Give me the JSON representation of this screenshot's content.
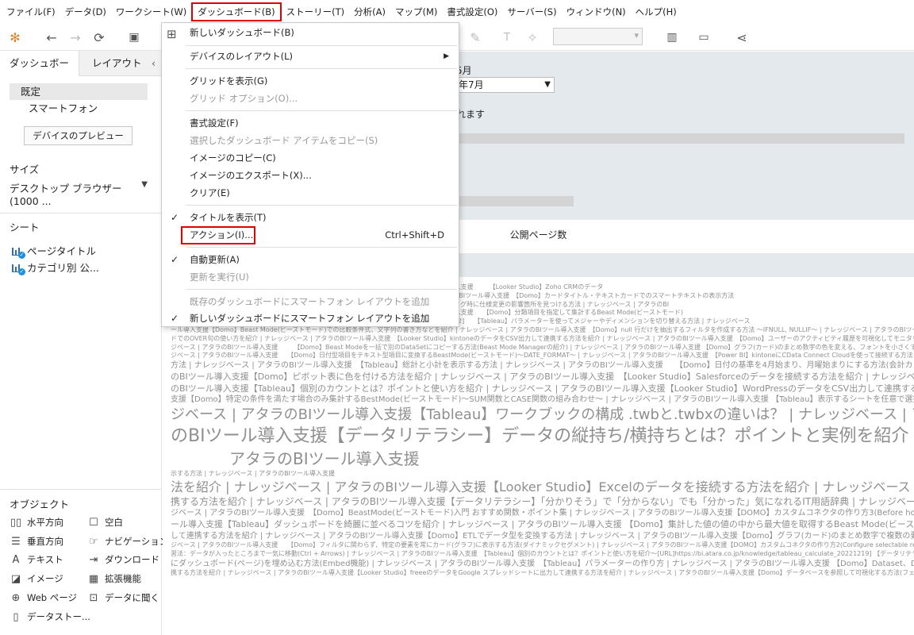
{
  "menubar": {
    "items": [
      "ファイル(F)",
      "データ(D)",
      "ワークシート(W)",
      "ダッシュボード(B)",
      "ストーリー(T)",
      "分析(A)",
      "マップ(M)",
      "書式設定(O)",
      "サーバー(S)",
      "ウィンドウ(N)",
      "ヘルプ(H)"
    ],
    "active_index": 3
  },
  "left_pane": {
    "tabs": [
      "ダッシュボード",
      "レイアウト"
    ],
    "devices": [
      "既定",
      "スマートフォン"
    ],
    "device_preview_button": "デバイスのプレビュー",
    "size_label": "サイズ",
    "size_value": "デスクトップ ブラウザー (1000 ...",
    "sheets_label": "シート",
    "sheets": [
      "ページタイトル",
      "カテゴリ別 公..."
    ],
    "objects_label": "オブジェクト",
    "objects": [
      {
        "label": "水平方向",
        "icon": "horizontal-container-icon"
      },
      {
        "label": "空白",
        "icon": "blank-icon"
      },
      {
        "label": "垂直方向",
        "icon": "vertical-container-icon"
      },
      {
        "label": "ナビゲーション",
        "icon": "navigation-icon"
      },
      {
        "label": "テキスト",
        "icon": "text-icon"
      },
      {
        "label": "ダウンロード",
        "icon": "download-icon"
      },
      {
        "label": "イメージ",
        "icon": "image-icon"
      },
      {
        "label": "拡張機能",
        "icon": "extension-icon"
      },
      {
        "label": "Web ページ",
        "icon": "web-page-icon"
      },
      {
        "label": "データに聞く",
        "icon": "ask-data-icon"
      },
      {
        "label": "データストー...",
        "icon": "data-story-icon"
      }
    ]
  },
  "canvas": {
    "month_label": "5月",
    "month_value": "年7月",
    "include_text": "れます",
    "page_views_title": "公開ページ数",
    "word_cloud_lines": [
      "blogにCData Connect Cloudを使って接続する方法を紹介 | ナレッジベース | アタラのBIツール導入支援　　　【Looker Studio】Zoho CRMのデータ",
      "ッシュボード(ページ)の自動更新を設定する方法(カンバニーページ設定) | ナレッジベース | アタラのBIツール導入支援　【Domo】カードタイトル・テキストカードでのスマートテキストの表示方法",
      "INDEX/MATCH) | ナレッジベース | アタラのBIツール導入支援　　【Domo】SQL DataFlowのデバッグ時に仕様変更の影響箇所を見つける方法 | ナレッジベース | アタラのBI",
      "【Tableau】インポートしたデータを定期的に更新する方法 | ナレッジベース | アタラのBIツール導入支援　　【Domo】分類項目を指定して集計するBeast Mode(ビーストモード)",
      "ード別/年次の比較...　WebURL]https://bi.atara.co.jp/knowledge/tableau_general_20221219_2]　　【Tableau】パラメーターを使ってメジャーやディメンションを切り替える方法 | ナレッジベース",
      "ール導入支援【Domo】Beast Mode(ビーストモード)での比較条件式、文字列の書き方などを紹介 | ナレッジベース | アタラのBIツール導入支援　【Domo】null 行だけを抽出するフィルタを作成する方法 ～IFNULL, NULLIF～ | ナレッジベース | アタラのBIツール導入支援 【Domo】Workbe",
      "ドでのOVER句の使い方を紹介 | ナレッジベース | アタラのBIツール導入支援　【Looker Studio】kintoneのデータをCSV出力して連携する方法を紹介 | ナレッジベース | アタラのBIツール導入支援　【Domo】ユーザーのアクティビティ履歴を可視化してモニタリングする方法 | ナレッジベース",
      "ジベース | アタラのBIツール導入支援　　　【Domo】Beast Modeを一括で別のDataSetにコピーする方法(Beast Mode Managerの紹介) | ナレッジベース | アタラのBIツール導入支援 【Domo】グラフ(カード)のまとめ数字の色を変える、フォントを小さくする方法 | ナレッジベース",
      "ジベース | アタラのBIツール導入支援　　【Domo】日付型項目をテキスト型項目に変換するBeastMode(ビーストモード)～DATE_FORMAT～ | ナレッジベース | アタラのBIツール導入支援　【Power BI】kintoneにCData Connect Cloudを使って接続する方法を紹介 | ナレッジベース",
      "方法 | ナレッジベース | アタラのBIツール導入支援　【Tableau】総計と小計を表示する方法 | ナレッジベース | アタラのBIツール導入支援　　【Domo】日付の基準を4月始まり、月曜始まりにする方法(会計カレンダーの設定) | ナレッジベース | アタラのBIツール導入支援",
      "のBIツール導入支援【Domo】ピボット表に色を付ける方法を紹介 | ナレッジベース | アタラのBIツール導入支援　【Looker Studio】Salesforceのデータを接続する方法を紹介 | ナレッジベース | アタラのBIツール導入",
      "のBIツール導入支援【Tableau】個別のカウントとは？ポイントと使い方を紹介 | ナレッジベース | アタラのBIツール導入支援【Looker Studio】WordPressのデータをCSV出力して連携する方法を紹介 | ナレッジベース | アタラのBI",
      "支援【Domo】特定の条件を満たす場合のみ集計するBestMode(ビーストモード)～SUM関数とCASE関数の組み合わせ～ | ナレッジベース | アタラのBIツール導入支援 【Tableau】表示するシートを任意で選択させるシートスワップの方法",
      "ジベース | アタラのBIツール導入支援【Tableau】ワークブックの構成 .twbと.twbxの違いは？ | ナレッジベース | アタラのBIツール導入支援",
      "のBIツール導入支援【データリテラシー】データの縦持ち/横持ちとは？ポイントと実例を紹介 | ナレッジベース |　【Domo】画像を活用",
      "アタラのBIツール導入支援",
      "示する方法 | ナレッジベース | アタラのBIツール導入支援",
      "法を紹介 | ナレッジベース | アタラのBIツール導入支援【Looker Studio】Excelのデータを接続する方法を紹介 | ナレッジベース | アタラのBIツール導入支",
      "携する方法を紹介 | ナレッジベース | アタラのBIツール導入支援【データリテラシー】「分かりそう」で「分からない」でも「分かった」気になれるIT用語辞典 | ナレッジベース | アタラのBIツール導入支援",
      "ジベース | アタラのBIツール導入支援　【Domo】BeastMode(ビーストモード)入門 おすすめ関数・ポイント集 | ナレッジベース | アタラのBIツール導入支援【DOMO】カスタムコネクタの作り方3(Before how data is processed編) | ナレッジベース",
      "ール導入支援【Tableau】ダッシュボードを綺麗に並べるコツを紹介 | ナレッジベース | アタラのBIツール導入支援 【Domo】集計した値の値の中から最大値を取得するBeast Mode(ビーストモード)(FIXED関数) | ナレッジベース | アタラのBIツール導入支援",
      "して連携する方法を紹介 | ナレッジベース | アタラのBIツール導入支援【Domo】ETLでデータ型を変換する方法 | ナレッジベース | アタラのBIツール導入支援【Domo】グラフ(カード)のまとめ数字で複数の要素を入れてカスタマイズする方法 | ナレッジベース | アタラのBIツール導入支援",
      "ジベース | アタラのBIツール導入支援　　【Domo】フィルタに関わらず、特定の要素を常にカード(グラフ)に表示する方法(ダイナミックセグメント) | ナレッジベース | アタラのBIツール導入支援【DOMO】カスタムコネクタの作り方2(Configure selectable reports編) | ナレッジベース",
      "習法：データが入ったところまで一気に移動(Ctrl + Arrows) | ナレッジベース | アタラのBIツール導入支援　【Tableau】個別のカウントとは？ポイントと使い方を紹介～[URL]https://bi.atara.co.jp/knowledge/tableau_calculate_20221219] 【データリテラシー】テキスト型データの0、NULL、",
      "にダッシュボード(ページ)を埋め込む方法(Embed機能) | ナレッジベース | アタラのBIツール導入支援　【Tableau】パラメーターの作り方 | ナレッジベース | アタラのBIツール導入支援 【Domo】Dataset、Dataflow(ETL)の所有者を一括で変更する方法 | ナレッジベース",
      "携する方法を紹介 | ナレッジベース | アタラのBIツール導入支援【Looker Studio】freeeのデータをGoogle スプレッドシートに出力して連携する方法を紹介 | ナレッジベース | アタラのBIツール導入支援【Domo】データベースを参照して可視化する方法(フェデレーテッド機能) | ナレッジベース"
    ]
  },
  "dropdown": {
    "items": [
      {
        "label": "新しいダッシュボード(B)",
        "enabled": true
      },
      {
        "label": "デバイスのレイアウト(L)",
        "enabled": true,
        "submenu": true
      },
      {
        "label": "グリッドを表示(G)",
        "enabled": true
      },
      {
        "label": "グリッド オプション(O)...",
        "enabled": false
      },
      {
        "label": "書式設定(F)",
        "enabled": true
      },
      {
        "label": "選択したダッシュボード アイテムをコピー(S)",
        "enabled": false
      },
      {
        "label": "イメージのコピー(C)",
        "enabled": true
      },
      {
        "label": "イメージのエクスポート(X)...",
        "enabled": true
      },
      {
        "label": "クリア(E)",
        "enabled": true
      },
      {
        "label": "タイトルを表示(T)",
        "enabled": true,
        "checked": true
      },
      {
        "label": "アクション(I)...",
        "enabled": true,
        "shortcut": "Ctrl+Shift+D",
        "highlighted": true
      },
      {
        "label": "自動更新(A)",
        "enabled": true,
        "checked": true
      },
      {
        "label": "更新を実行(U)",
        "enabled": false
      },
      {
        "label": "既存のダッシュボードにスマートフォン レイアウトを追加",
        "enabled": false
      },
      {
        "label": "新しいダッシュボードにスマートフォン レイアウトを追加",
        "enabled": true,
        "checked": true
      }
    ]
  },
  "colors": {
    "highlight_border": "#e00000",
    "filter_panel_bg": "#e3e9ec",
    "word_cloud_text": "#8f8f8f",
    "sheet_icon_blue": "#2f6fb3"
  }
}
